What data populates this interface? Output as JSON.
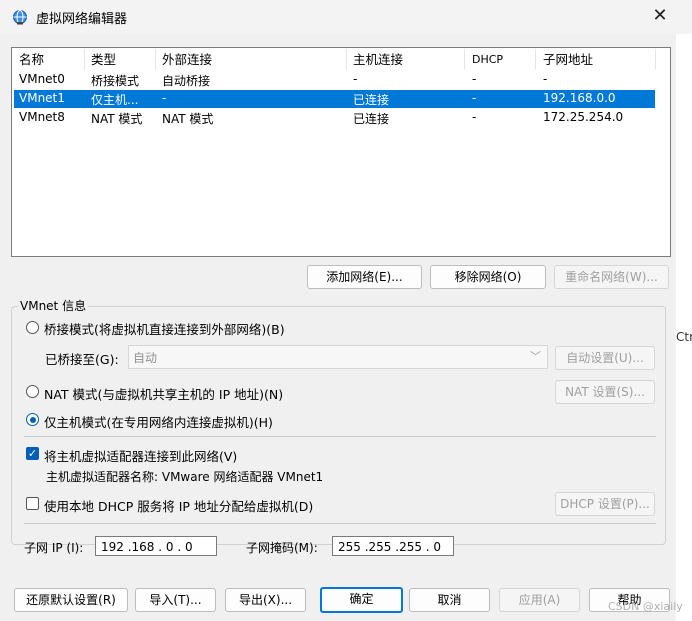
{
  "window": {
    "title": "虚拟网络编辑器",
    "close": "✕"
  },
  "side_text": "Ctr",
  "table": {
    "headers": [
      "名称",
      "类型",
      "外部连接",
      "主机连接",
      "DHCP",
      "子网地址"
    ],
    "rows": [
      [
        "VMnet0",
        "桥接模式",
        "自动桥接",
        "-",
        "-",
        "-"
      ],
      [
        "VMnet1",
        "仅主机...",
        "-",
        "已连接",
        "-",
        "192.168.0.0"
      ],
      [
        "VMnet8",
        "NAT 模式",
        "NAT 模式",
        "已连接",
        "-",
        "172.25.254.0"
      ]
    ],
    "selected_row": 1
  },
  "list_buttons": {
    "add": "添加网络(E)...",
    "remove": "移除网络(O)",
    "rename": "重命名网络(W)..."
  },
  "vmnet_info": {
    "group_label": "VMnet 信息",
    "bridge_radio": "桥接模式(将虚拟机直接连接到外部网络)(B)",
    "bridged_to_label": "已桥接至(G):",
    "bridged_to_value": "自动",
    "auto_settings": "自动设置(U)...",
    "nat_radio": "NAT 模式(与虚拟机共享主机的 IP 地址)(N)",
    "nat_settings": "NAT 设置(S)...",
    "hostonly_radio": "仅主机模式(在专用网络内连接虚拟机)(H)",
    "connect_adapter": "将主机虚拟适配器连接到此网络(V)",
    "adapter_name": "主机虚拟适配器名称: VMware 网络适配器 VMnet1",
    "dhcp_check": "使用本地 DHCP 服务将 IP 地址分配给虚拟机(D)",
    "dhcp_settings": "DHCP 设置(P)...",
    "subnet_ip_label": "子网 IP (I):",
    "subnet_ip": "192 .168 .  0  .  0",
    "subnet_mask_label": "子网掩码(M):",
    "subnet_mask": "255 .255 .255 .  0"
  },
  "footer": {
    "restore": "还原默认设置(R)",
    "import": "导入(T)...",
    "export": "导出(X)...",
    "ok": "确定",
    "cancel": "取消",
    "apply": "应用(A)",
    "help": "帮助"
  },
  "watermark": "CSDN @xiaily",
  "colors": {
    "selection": "#0078d7",
    "accent": "#005fb8"
  }
}
